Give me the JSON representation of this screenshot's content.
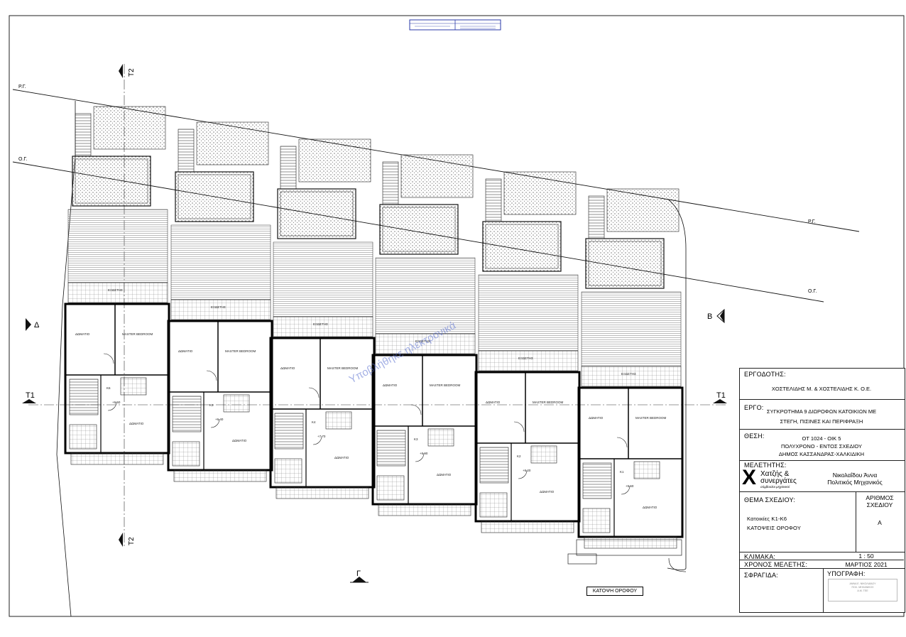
{
  "header_table": {
    "left": "",
    "right": ""
  },
  "markers": {
    "section_t1": "T1",
    "section_t2": "T2",
    "section_delta": "Δ",
    "section_beta": "B",
    "section_gamma": "Γ",
    "property_line": "Ρ.Γ.",
    "building_line": "Ο.Γ."
  },
  "room_labels": {
    "room": "ΔΩΜΑΤΙΟ",
    "master_bedroom": "MASTER BEDROOM",
    "balcony": "ΕΞΩΣΤΗΣ",
    "units": [
      "K6",
      "K5",
      "K4",
      "K3",
      "K2",
      "K1"
    ],
    "levels": [
      "+6.50",
      "+6.40",
      "+7.70",
      "+6.90",
      "+6.20",
      "+5.60"
    ]
  },
  "watermark": "Υποβλήθηκε ηλεκτρονικά",
  "titleblock": {
    "client_label": "ΕΡΓΟΔΟΤΗΣ:",
    "client": "ΧΟΣΤΕΛΙΔΗΣ Μ. & ΧΟΣΤΕΛΙΔΗΣ Κ. Ο.Ε.",
    "project_label": "ΕΡΓΟ:",
    "project_line1": "ΣΥΓΚΡΟΤΗΜΑ 9 ΔΙΩΡΟΦΩΝ ΚΑΤΟΙΚΙΩΝ ΜΕ",
    "project_line2": "ΣΤΕΓΗ, ΠΙΣΙΝΕΣ ΚΑΙ ΠΕΡΙΦΡΑΞΗ",
    "location_label": "ΘΕΣΗ:",
    "location_line1": "ΟΤ 1024 - ΟΙΚ 5",
    "location_line2": "ΠΟΛΥΧΡΟΝΟ - ΕΝΤΟΣ ΣΧΕΔΙΟΥ",
    "location_line3": "ΔΗΜΟΣ ΚΑΣΣΑΝΔΡΑΣ-ΧΑΛΚΙΔΙΚΗ",
    "designer_label": "ΜΕΛΕΤΗΤΗΣ:",
    "firm_letter": "X",
    "firm_name1": "Χατζής &",
    "firm_name2": "συνεργάτες",
    "firm_sub": "σύμβουλοι μηχανικοί",
    "engineer_name": "Νικολαΐδου Άννα",
    "engineer_title": "Πολιτικός Μηχανικός",
    "subject_label": "ΘΕΜΑ ΣΧΕΔΙΟΥ:",
    "subject_line1": "Κατοικίες Κ1-Κ6",
    "subject_line2": "ΚΑΤΟΨΕΙΣ ΟΡΟΦΟΥ",
    "number_label1": "ΑΡΙΘΜΟΣ",
    "number_label2": "ΣΧΕΔΙΟΥ",
    "number_value": "Α",
    "scale_label": "ΚΛΙΜΑΚΑ:",
    "scale_value": "1 : 50",
    "date_label": "ΧΡΟΝΟΣ ΜΕΛΕΤΗΣ:",
    "date_value": "ΜΑΡΤΙΟΣ 2021",
    "stamp_label": "ΣΦΡΑΓΙΔΑ:",
    "signature_label": "ΥΠΟΓΡΑΦΗ:"
  },
  "drawing_caption": "ΚΑΤΟΨΗ ΟΡΟΦΟΥ",
  "colors": {
    "line": "#1a1a1a",
    "hatch": "#555555",
    "watermark": "#5a6fd0",
    "accent": "#2a3aa8"
  }
}
